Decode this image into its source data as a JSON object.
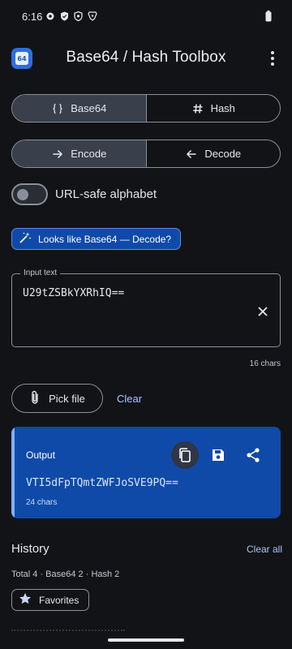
{
  "status_bar": {
    "time": "6:16"
  },
  "app_bar": {
    "title": "Base64 / Hash Toolbox",
    "logo_text": "64"
  },
  "mode_tabs": [
    {
      "label": "Base64",
      "icon": "braces-icon",
      "selected": true
    },
    {
      "label": "Hash",
      "icon": "hash-icon",
      "selected": false
    }
  ],
  "direction_tabs": [
    {
      "label": "Encode",
      "icon": "arrow-right-icon",
      "selected": true
    },
    {
      "label": "Decode",
      "icon": "arrow-left-icon",
      "selected": false
    }
  ],
  "url_safe": {
    "label": "URL-safe alphabet",
    "enabled": false
  },
  "hint_chip": {
    "label": "Looks like Base64 — Decode?",
    "icon": "magic-wand-icon"
  },
  "input": {
    "label": "Input text",
    "value": "U29tZSBkYXRhIQ==",
    "char_count": "16 chars"
  },
  "actions": {
    "pick_file": "Pick file",
    "clear": "Clear"
  },
  "output": {
    "title": "Output",
    "value": "VTI5dFpTQmtZWFJoSVE9PQ==",
    "char_count": "24 chars"
  },
  "history": {
    "title": "History",
    "clear_all": "Clear all",
    "stats": "Total 4 · Base64 2 · Hash 2",
    "favorites_label": "Favorites"
  },
  "colors": {
    "background": "#121316",
    "accent_blue": "#0f4aa8",
    "link": "#a9c5ff",
    "selected_segment": "#3a3f4c"
  }
}
